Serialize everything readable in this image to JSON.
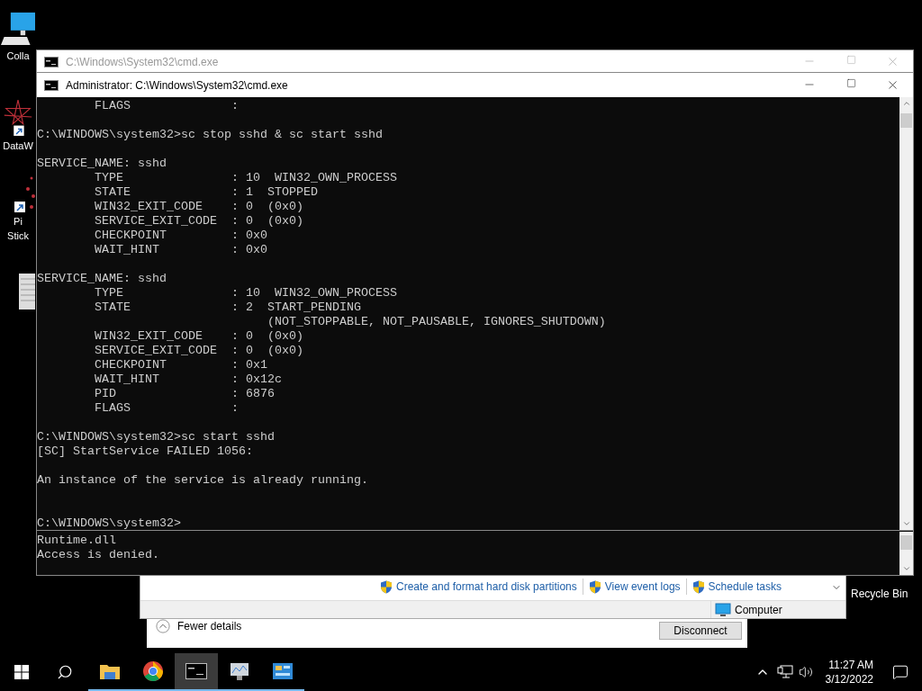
{
  "desktop_icons": [
    {
      "kind": "computer",
      "lines": [
        "Colla"
      ]
    },
    {
      "kind": "starburst",
      "lines": [
        "DataW"
      ]
    },
    {
      "kind": "dots",
      "lines": [
        "Pi",
        "Stick"
      ]
    },
    {
      "kind": "document"
    }
  ],
  "recycle_bin": {
    "label": "Recycle Bin"
  },
  "remote_dialog": {
    "toggle": "Fewer details",
    "button": "Disconnect"
  },
  "management_window": {
    "links": [
      "Create and format hard disk partitions",
      "View event logs",
      "Schedule tasks"
    ],
    "status": "Computer"
  },
  "back_console": {
    "title": "C:\\Windows\\System32\\cmd.exe",
    "active": false,
    "lines": [
      "Runtime.dll",
      "Access is denied."
    ]
  },
  "front_console": {
    "title": "Administrator: C:\\Windows\\System32\\cmd.exe",
    "active": true,
    "blocks": [
      {
        "lines": [
          "        FLAGS              :"
        ]
      },
      {
        "lines": [
          "C:\\WINDOWS\\system32>sc stop sshd & sc start sshd"
        ]
      },
      {
        "lines": [
          "SERVICE_NAME: sshd",
          "        TYPE               : 10  WIN32_OWN_PROCESS",
          "        STATE              : 1  STOPPED",
          "        WIN32_EXIT_CODE    : 0  (0x0)",
          "        SERVICE_EXIT_CODE  : 0  (0x0)",
          "        CHECKPOINT         : 0x0",
          "        WAIT_HINT          : 0x0"
        ]
      },
      {
        "lines": [
          "SERVICE_NAME: sshd",
          "        TYPE               : 10  WIN32_OWN_PROCESS",
          "        STATE              : 2  START_PENDING",
          "                                (NOT_STOPPABLE, NOT_PAUSABLE, IGNORES_SHUTDOWN)",
          "        WIN32_EXIT_CODE    : 0  (0x0)",
          "        SERVICE_EXIT_CODE  : 0  (0x0)",
          "        CHECKPOINT         : 0x1",
          "        WAIT_HINT          : 0x12c",
          "        PID                : 6876",
          "        FLAGS              :"
        ]
      },
      {
        "lines": [
          "C:\\WINDOWS\\system32>sc start sshd",
          "[SC] StartService FAILED 1056:"
        ]
      },
      {
        "lines": [
          "An instance of the service is already running."
        ]
      },
      {
        "lines": [
          "C:\\WINDOWS\\system32>"
        ],
        "spaced": true
      }
    ]
  },
  "taskbar": {
    "apps": [
      {
        "kind": "folder",
        "active": false
      },
      {
        "kind": "browser",
        "active": false
      },
      {
        "kind": "console",
        "active": true
      },
      {
        "kind": "monitor",
        "active": false
      },
      {
        "kind": "dashboard",
        "active": false
      }
    ],
    "time": "11:27 AM",
    "date": "3/12/2022"
  }
}
